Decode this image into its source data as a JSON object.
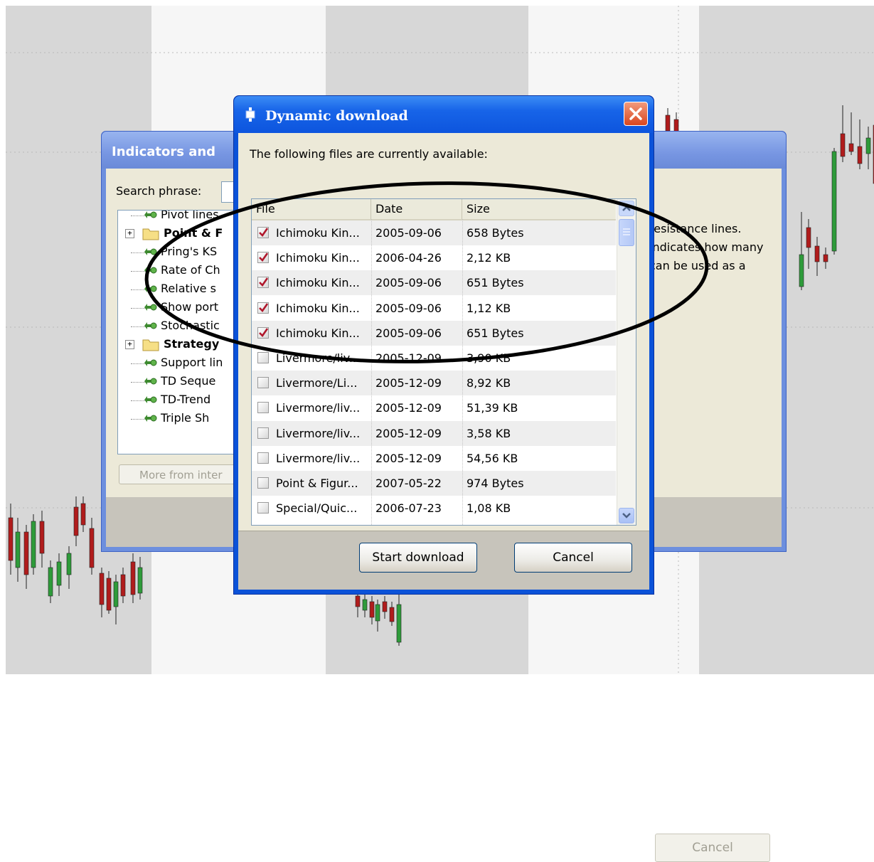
{
  "back_dialog": {
    "title": "Indicators and",
    "search_label": "Search phrase:",
    "tree_items": [
      {
        "label": "Pivot lines",
        "type": "leaf",
        "bold": false
      },
      {
        "label": "Point & F",
        "type": "folder",
        "bold": true
      },
      {
        "label": "Pring's KS",
        "type": "leaf",
        "bold": false
      },
      {
        "label": "Rate of Ch",
        "type": "leaf",
        "bold": false
      },
      {
        "label": "Relative s",
        "type": "leaf",
        "bold": false
      },
      {
        "label": "Show port",
        "type": "leaf",
        "bold": false
      },
      {
        "label": "Stochastic",
        "type": "leaf",
        "bold": false
      },
      {
        "label": "Strategy",
        "type": "folder",
        "bold": true
      },
      {
        "label": "Support lin",
        "type": "leaf",
        "bold": false
      },
      {
        "label": "TD Seque",
        "type": "leaf",
        "bold": false
      },
      {
        "label": "TD-Trend",
        "type": "leaf",
        "bold": false
      },
      {
        "label": "Triple Sh",
        "type": "leaf",
        "bold": false
      }
    ],
    "more_button": "More from inter",
    "description_lines": [
      "resistance lines.",
      "indicates how many",
      "can be used as a"
    ],
    "cancel_button": "Cancel"
  },
  "dialog": {
    "title": "Dynamic download",
    "available_label": "The following files are currently available:",
    "columns": {
      "file": "File",
      "date": "Date",
      "size": "Size"
    },
    "files": [
      {
        "name": "Ichimoku Kin...",
        "date": "2005-09-06",
        "size": "658 Bytes",
        "checked": true
      },
      {
        "name": "Ichimoku Kin...",
        "date": "2006-04-26",
        "size": "2,12 KB",
        "checked": true
      },
      {
        "name": "Ichimoku Kin...",
        "date": "2005-09-06",
        "size": "651 Bytes",
        "checked": true
      },
      {
        "name": "Ichimoku Kin...",
        "date": "2005-09-06",
        "size": "1,12 KB",
        "checked": true
      },
      {
        "name": "Ichimoku Kin...",
        "date": "2005-09-06",
        "size": "651 Bytes",
        "checked": true
      },
      {
        "name": "Livermore/liv...",
        "date": "2005-12-09",
        "size": "3,90 KB",
        "checked": false
      },
      {
        "name": "Livermore/Li...",
        "date": "2005-12-09",
        "size": "8,92 KB",
        "checked": false
      },
      {
        "name": "Livermore/liv...",
        "date": "2005-12-09",
        "size": "51,39 KB",
        "checked": false
      },
      {
        "name": "Livermore/liv...",
        "date": "2005-12-09",
        "size": "3,58 KB",
        "checked": false
      },
      {
        "name": "Livermore/liv...",
        "date": "2005-12-09",
        "size": "54,56 KB",
        "checked": false
      },
      {
        "name": "Point & Figur...",
        "date": "2007-05-22",
        "size": "974 Bytes",
        "checked": false
      },
      {
        "name": "Special/Quic...",
        "date": "2006-07-23",
        "size": "1,08 KB",
        "checked": false
      }
    ],
    "start_button": "Start download",
    "cancel_button": "Cancel"
  },
  "colors": {
    "check_mark": "#b0182c",
    "titlebar_blue": "#0b52d8",
    "candle_red": "#b01c1c",
    "candle_green": "#2e9b3a"
  }
}
